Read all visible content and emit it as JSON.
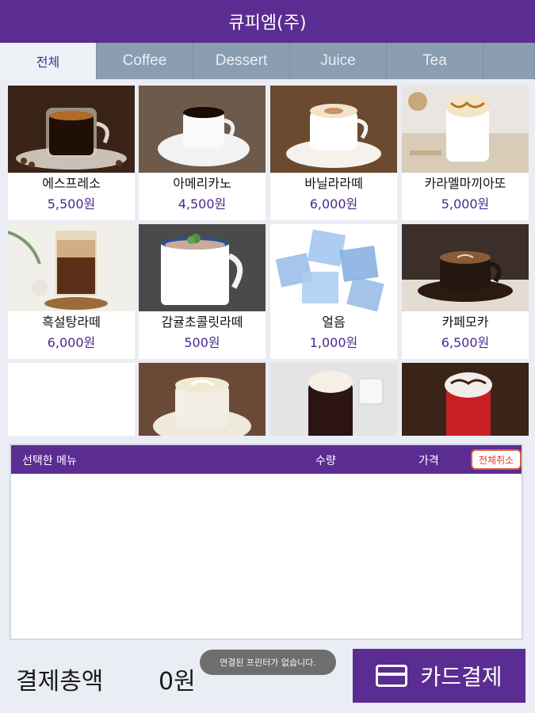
{
  "header": {
    "title": "큐피엠(주)"
  },
  "tabs": [
    {
      "label": "전체"
    },
    {
      "label": "Coffee"
    },
    {
      "label": "Dessert"
    },
    {
      "label": "Juice"
    },
    {
      "label": "Tea"
    }
  ],
  "menu": {
    "items": [
      {
        "name": "에스프레소",
        "price": "5,500원"
      },
      {
        "name": "아메리카노",
        "price": "4,500원"
      },
      {
        "name": "바닐라라떼",
        "price": "6,000원"
      },
      {
        "name": "카라멜마끼아또",
        "price": "5,000원"
      },
      {
        "name": "흑설탕라떼",
        "price": "6,000원"
      },
      {
        "name": "감귤초콜릿라떼",
        "price": "500원"
      },
      {
        "name": "얼음",
        "price": "1,000원"
      },
      {
        "name": "카페모카",
        "price": "6,500원"
      }
    ]
  },
  "order": {
    "col_menu": "선택한 메뉴",
    "col_qty": "수량",
    "col_price": "가격",
    "cancel_all": "전체취소"
  },
  "footer": {
    "total_label": "결제총액",
    "total_value": "0원",
    "toast": "연결된 프린터가 없습니다.",
    "pay_label": "카드결제"
  },
  "colors": {
    "brand": "#5b2c91",
    "tab_bar": "#8b9db1",
    "price": "#4a2a8e",
    "cancel": "#d6402a"
  }
}
